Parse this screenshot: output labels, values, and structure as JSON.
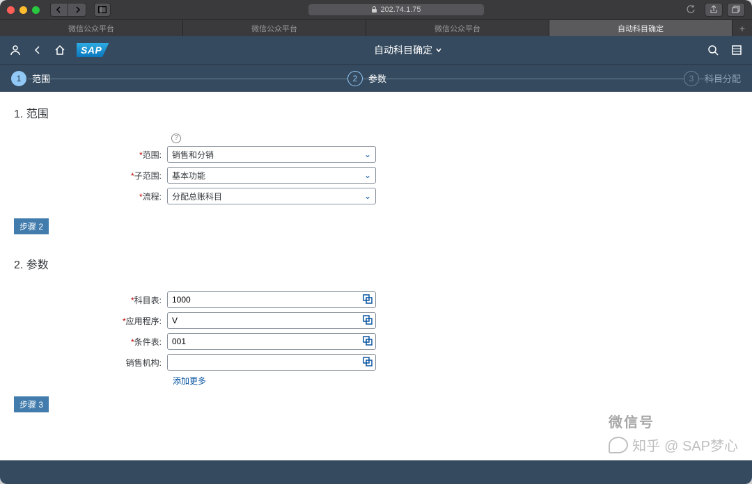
{
  "browser": {
    "url": "202.74.1.75",
    "tabs": [
      "微信公众平台",
      "微信公众平台",
      "微信公众平台",
      "自动科目确定"
    ],
    "active_tab_index": 3
  },
  "shell": {
    "title": "自动科目确定",
    "logo_text": "SAP"
  },
  "wizard": {
    "steps": [
      {
        "num": "1",
        "label": "范围"
      },
      {
        "num": "2",
        "label": "参数"
      },
      {
        "num": "3",
        "label": "科目分配"
      }
    ]
  },
  "section1": {
    "title": "1. 范围",
    "fields": {
      "scope_label": "范围:",
      "scope_value": "销售和分销",
      "subscope_label": "子范围:",
      "subscope_value": "基本功能",
      "process_label": "流程:",
      "process_value": "分配总账科目"
    },
    "step_button": "步骤 2"
  },
  "section2": {
    "title": "2. 参数",
    "fields": {
      "chart_label": "科目表:",
      "chart_value": "1000",
      "app_label": "应用程序:",
      "app_value": "V",
      "cond_label": "条件表:",
      "cond_value": "001",
      "sales_label": "销售机构:",
      "sales_value": ""
    },
    "add_more": "添加更多",
    "step_button": "步骤 3"
  },
  "footer": {
    "left": "",
    "right": ""
  },
  "watermark": {
    "brand": "知乎",
    "author": "@ SAP梦心"
  }
}
